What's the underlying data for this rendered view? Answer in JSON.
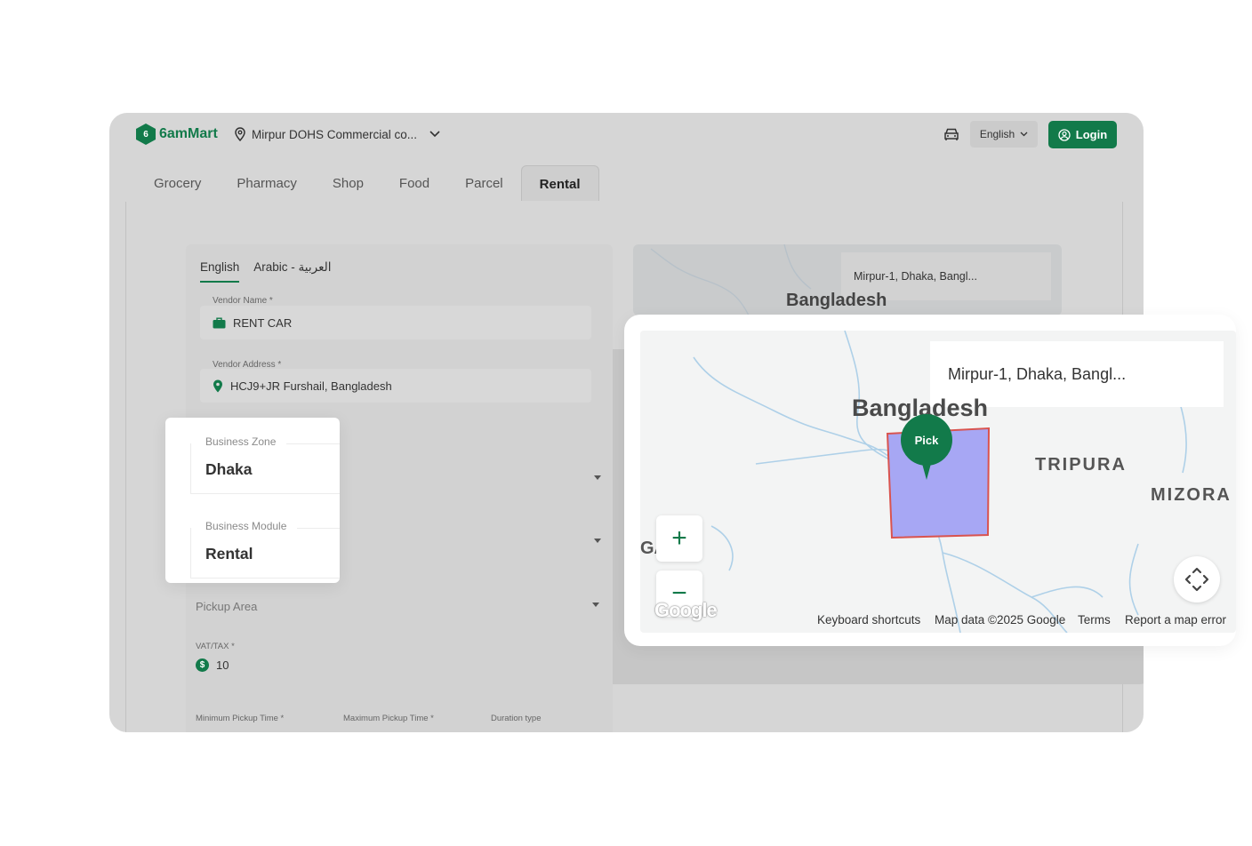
{
  "header": {
    "brand": "6amMart",
    "brand_mark": "6",
    "location": "Mirpur DOHS Commercial co...",
    "language": "English",
    "login_label": "Login"
  },
  "tabs": [
    {
      "label": "Grocery"
    },
    {
      "label": "Pharmacy"
    },
    {
      "label": "Shop"
    },
    {
      "label": "Food"
    },
    {
      "label": "Parcel"
    },
    {
      "label": "Rental",
      "active": true
    }
  ],
  "form": {
    "lang_tabs": [
      "English",
      "Arabic - العربية"
    ],
    "vendor_name_label": "Vendor Name *",
    "vendor_name": "RENT CAR",
    "vendor_address_label": "Vendor Address *",
    "vendor_address": "HCJ9+JR Furshail, Bangladesh",
    "pickup_area_label": "Pickup Area",
    "vat_label": "VAT/TAX *",
    "vat_value": "10",
    "min_pickup_label": "Minimum Pickup Time *",
    "max_pickup_label": "Maximum Pickup Time *",
    "duration_label": "Duration type"
  },
  "small_map": {
    "search": "Mirpur-1, Dhaka, Bangl...",
    "label": "Bangladesh"
  },
  "business": {
    "zone_label": "Business Zone",
    "zone_value": "Dhaka",
    "module_label": "Business Module",
    "module_value": "Rental"
  },
  "map": {
    "search": "Mirpur-1, Dhaka, Bangl...",
    "country": "Bangladesh",
    "region1": "TRIPURA",
    "region2": "MIZORA",
    "edge_label": "GA",
    "pin_label": "Pick",
    "zoom_in": "+",
    "zoom_out": "−",
    "google": "Google",
    "keyboard": "Keyboard shortcuts",
    "map_data": "Map data ©2025 Google",
    "terms": "Terms",
    "report": "Report a map error",
    "zone_fill": "#a7a7f4",
    "zone_stroke": "#d9534f"
  },
  "colors": {
    "brand": "#127a4a"
  }
}
